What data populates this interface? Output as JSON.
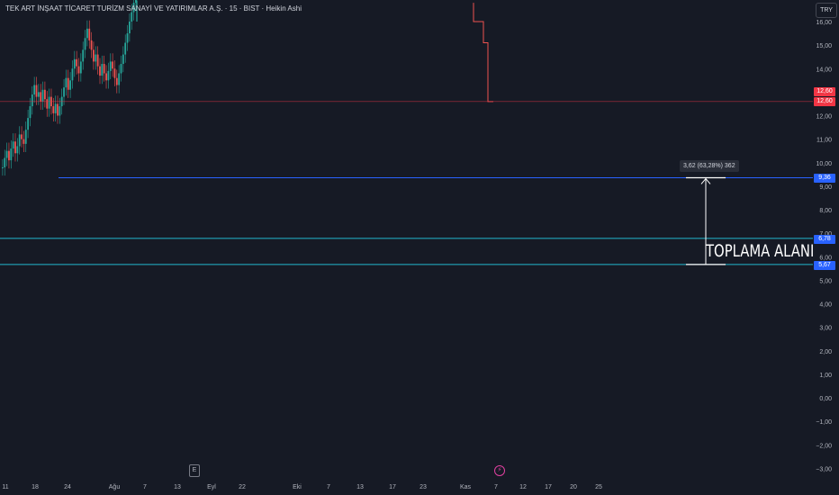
{
  "header": {
    "title": "TEK ART İNŞAAT TİCARET TURİZM SANAYİ VE YATIRIMLAR A.Ş. · 15 · BIST · Heikin Ashi",
    "currency_button": "TRY"
  },
  "colors": {
    "background": "#161a25",
    "up_candle": "#26a69a",
    "down_candle": "#ef5350",
    "price_line": "#f23645",
    "target_line": "#2962ff",
    "zone_line": "#22b8cf",
    "blue_badge": "#2962ff"
  },
  "badges": {
    "price_top": "12,60",
    "price_bottom": "12,60",
    "level_target": "9,36",
    "level_upper": "6,78",
    "level_lower": "5,67"
  },
  "annotations": {
    "measure_label": "3,62 (63,28%) 362",
    "zone_label": "TOPLAMA ALANI",
    "earnings_marker": "E",
    "dividend_marker": "⚡"
  },
  "chart_data": {
    "type": "candlestick",
    "style": "Heikin Ashi",
    "yaxis": {
      "range": [
        -3.2,
        16.6
      ],
      "ticks": [
        "16,00",
        "15,00",
        "14,00",
        "13,00",
        "12,00",
        "11,00",
        "10,00",
        "9,00",
        "8,00",
        "7,00",
        "6,00",
        "5,00",
        "4,00",
        "3,00",
        "2,00",
        "1,00",
        "0,00",
        "−1,00",
        "−2,00",
        "−3,00"
      ],
      "tick_values": [
        16,
        15,
        14,
        13,
        12,
        11,
        10,
        9,
        8,
        7,
        6,
        5,
        4,
        3,
        2,
        1,
        0,
        -1,
        -2,
        -3
      ]
    },
    "xaxis": {
      "ticks": [
        "11",
        "18",
        "24",
        "Ağu",
        "7",
        "13",
        "Eyl",
        "22",
        "Eki",
        "7",
        "13",
        "17",
        "23",
        "Kas",
        "7",
        "12",
        "17",
        "20",
        "25"
      ]
    },
    "horizontal_levels": [
      {
        "value": 12.6,
        "color": "#f23645",
        "label": "12,60"
      },
      {
        "value": 9.36,
        "color": "#2962ff",
        "label": "9,36"
      },
      {
        "value": 6.78,
        "color": "#22b8cf",
        "label": "6,78"
      },
      {
        "value": 5.67,
        "color": "#22b8cf",
        "label": "5,67"
      }
    ],
    "measure": {
      "from": 5.67,
      "to": 9.36,
      "change": "3,62",
      "percent": "63,28%",
      "bars": "362"
    },
    "candles_approx": [
      9.8,
      10.2,
      10.5,
      10.1,
      10.6,
      10.9,
      10.4,
      10.7,
      11.2,
      11.0,
      10.8,
      11.4,
      11.9,
      12.4,
      12.9,
      13.3,
      12.8,
      13.0,
      12.6,
      13.1,
      12.7,
      12.3,
      12.8,
      12.4,
      12.1,
      12.5,
      12.0,
      12.4,
      12.8,
      13.2,
      13.6,
      13.1,
      13.5,
      14.0,
      14.4,
      14.1,
      13.8,
      14.3,
      14.8,
      15.3,
      15.7,
      15.2,
      14.8,
      14.3,
      14.6,
      14.1,
      13.7,
      14.2,
      13.8,
      13.5,
      13.9,
      14.3,
      14.0,
      13.6,
      13.3,
      13.8,
      14.2,
      14.6,
      15.1,
      15.5,
      16.0,
      16.4,
      16.8,
      17.2
    ],
    "late_series": [
      {
        "x_label": "Kas",
        "value": 16.0
      },
      {
        "x_label": "Kas",
        "value": 15.2
      },
      {
        "x_label": "Kas",
        "value": 12.6
      }
    ]
  }
}
